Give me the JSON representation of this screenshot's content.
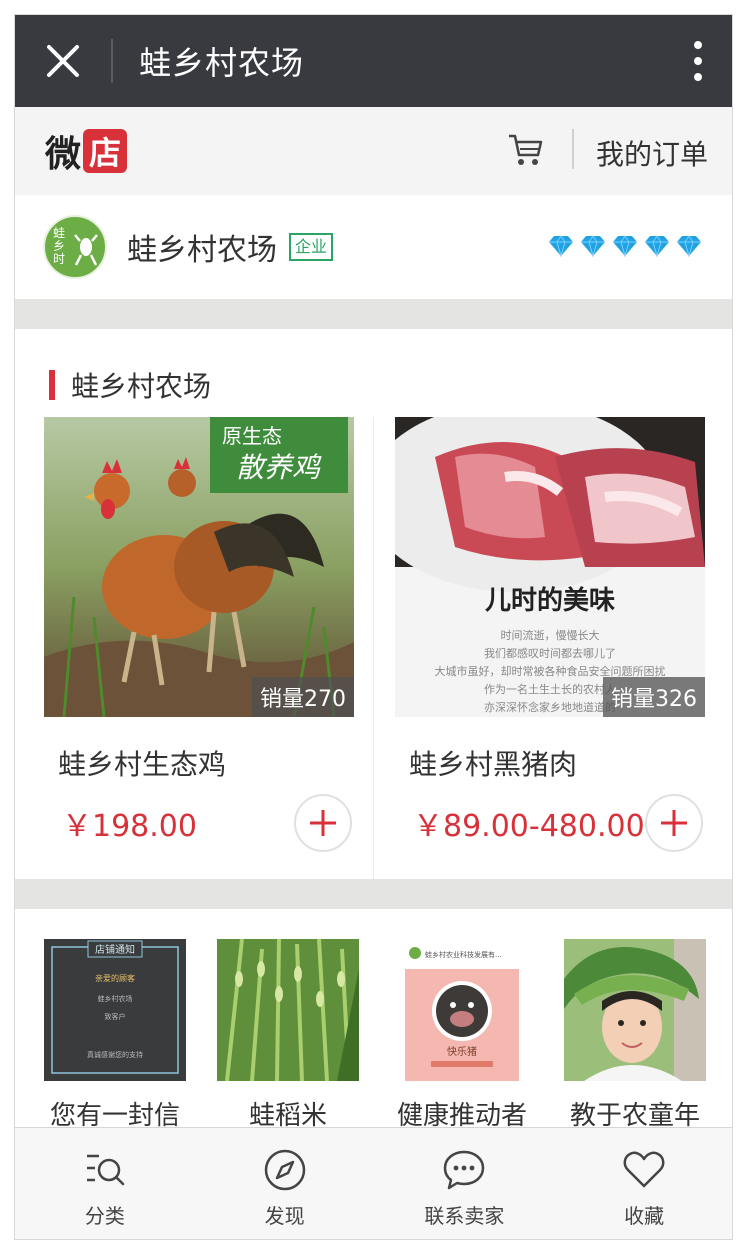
{
  "titlebar": {
    "title": "蛙乡村农场",
    "close_icon": "close-icon",
    "more_icon": "more-vertical-icon"
  },
  "header": {
    "logo_wei": "微",
    "logo_dian": "店",
    "cart_icon": "cart-icon",
    "orders_label": "我的订单"
  },
  "shop": {
    "avatar_text": "蛙乡时",
    "name": "蛙乡村农场",
    "badge": "企业",
    "rating_diamonds": 5,
    "diamond_color": "#1fa3e6"
  },
  "section": {
    "title": "蛙乡村农场",
    "accent": "#d8313a"
  },
  "products": [
    {
      "name": "蛙乡村生态鸡",
      "price": "￥198.00",
      "sales": "销量270",
      "banner_line1": "原生态",
      "banner_line2": "散养鸡"
    },
    {
      "name": "蛙乡村黑猪肉",
      "price": "￥89.00-480.00",
      "sales": "销量326",
      "poster_title": "儿时的美味",
      "poster_lines": [
        "时间流逝，慢慢长大",
        "我们都感叹时间都去哪儿了",
        "大城市虽好，却时常被各种食品安全问题所困扰",
        "作为一名土生土长的农村人",
        "亦深深怀念家乡地地道道的"
      ]
    }
  ],
  "recommendations": [
    {
      "label": "您有一封信",
      "notice_title": "店铺通知",
      "notice_lines": [
        "亲爱的顾客",
        "蛙乡村农场",
        "致客户",
        "真诚感谢您的支持"
      ]
    },
    {
      "label": "蛙稻米"
    },
    {
      "label": "健康推动者",
      "img_caption": "蛙乡村农业科技发展有...",
      "img_tag": "快乐猪"
    },
    {
      "label": "教于农童年"
    }
  ],
  "bottomnav": [
    {
      "label": "分类",
      "icon": "category-search-icon"
    },
    {
      "label": "发现",
      "icon": "compass-icon"
    },
    {
      "label": "联系卖家",
      "icon": "chat-bubble-icon"
    },
    {
      "label": "收藏",
      "icon": "heart-icon"
    }
  ]
}
